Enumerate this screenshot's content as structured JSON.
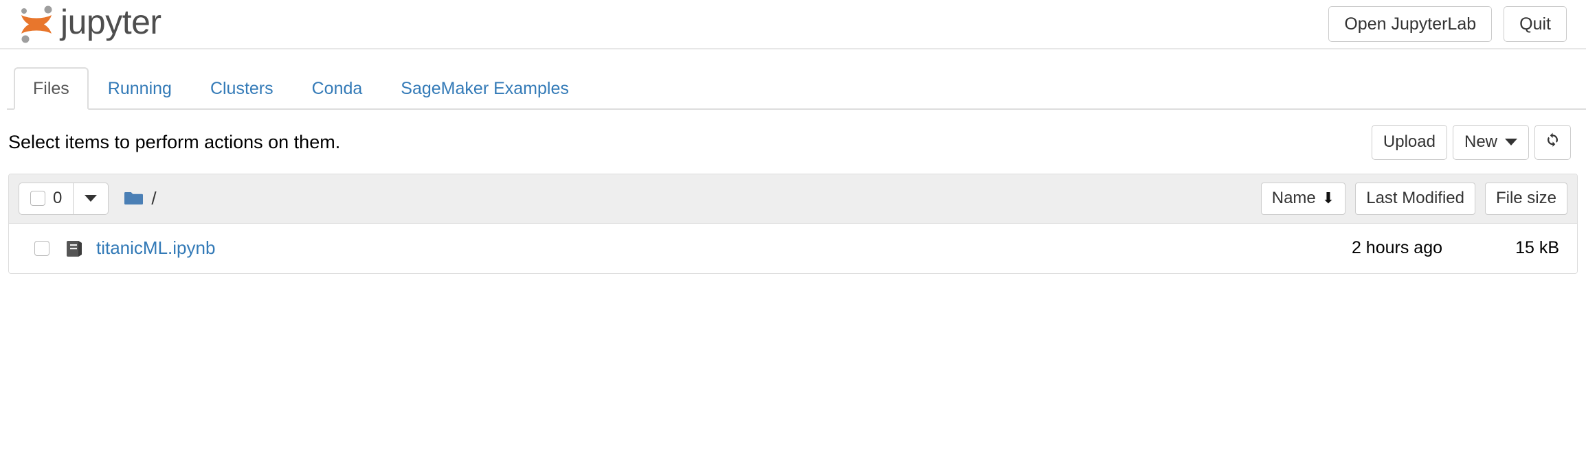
{
  "header": {
    "brand_text": "jupyter",
    "logo_icon": "jupyter-logo",
    "logo_orange": "#e8762c",
    "logo_gray": "#9e9e9e",
    "open_lab_label": "Open JupyterLab",
    "quit_label": "Quit"
  },
  "tabs": [
    {
      "label": "Files",
      "active": true
    },
    {
      "label": "Running",
      "active": false
    },
    {
      "label": "Clusters",
      "active": false
    },
    {
      "label": "Conda",
      "active": false
    },
    {
      "label": "SageMaker Examples",
      "active": false
    }
  ],
  "toolbar": {
    "message": "Select items to perform actions on them.",
    "upload_label": "Upload",
    "new_label": "New",
    "new_caret_icon": "chevron-down-icon",
    "refresh_icon": "refresh-icon"
  },
  "list_header": {
    "select_all_count": "0",
    "select_all_checkbox_icon": "checkbox-icon",
    "dropdown_caret_icon": "chevron-down-icon",
    "folder_icon": "folder-icon",
    "folder_color": "#4a7fb5",
    "breadcrumb_path": "/",
    "sort_name_label": "Name",
    "sort_name_arrow_icon": "arrow-down-icon",
    "sort_name_arrow_glyph": "⬇",
    "sort_modified_label": "Last Modified",
    "sort_size_label": "File size"
  },
  "files": [
    {
      "checkbox_icon": "checkbox-icon",
      "type_icon": "notebook-icon",
      "name": "titanicML.ipynb",
      "last_modified": "2 hours ago",
      "size": "15 kB"
    }
  ],
  "colors": {
    "link_blue": "#337ab7",
    "header_bg": "#eeeeee",
    "border_gray": "#dddddd"
  }
}
